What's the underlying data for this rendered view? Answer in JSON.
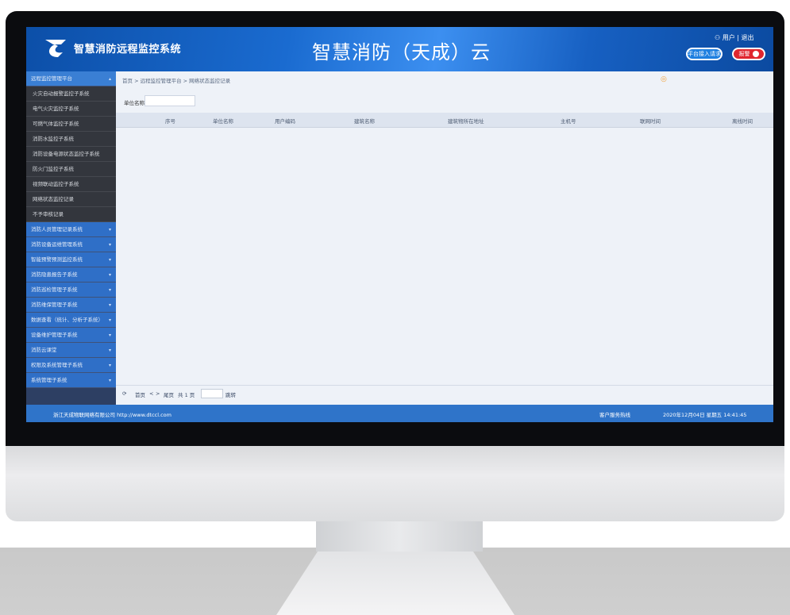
{
  "header": {
    "system_name": "智慧消防远程监控系统",
    "title": "智慧消防（天成）云",
    "user": "用户 | 退出",
    "button_alert": "平台接入请求",
    "button_alarm": "报警"
  },
  "sidebar": {
    "items": [
      {
        "label": "远程监控管理平台",
        "type": "active"
      },
      {
        "label": "火灾自动报警监控子系统",
        "type": "sub"
      },
      {
        "label": "电气火灾监控子系统",
        "type": "sub"
      },
      {
        "label": "可燃气体监控子系统",
        "type": "sub"
      },
      {
        "label": "消防水监控子系统",
        "type": "sub"
      },
      {
        "label": "消防设备电源状态监控子系统",
        "type": "sub"
      },
      {
        "label": "防火门监控子系统",
        "type": "sub"
      },
      {
        "label": "视频联动监控子系统",
        "type": "sub"
      },
      {
        "label": "网络状态监控记录",
        "type": "sub"
      },
      {
        "label": "不予审核记录",
        "type": "sub"
      },
      {
        "label": "消防人员管理记录系统",
        "type": "group"
      },
      {
        "label": "消防设备运维管理系统",
        "type": "group"
      },
      {
        "label": "智能预警预测监控系统",
        "type": "group"
      },
      {
        "label": "消防隐患报告子系统",
        "type": "group"
      },
      {
        "label": "消防巡检管理子系统",
        "type": "group"
      },
      {
        "label": "消防维保管理子系统",
        "type": "group"
      },
      {
        "label": "数据查看（统计、分析子系统）",
        "type": "group"
      },
      {
        "label": "设备维护管理子系统",
        "type": "group"
      },
      {
        "label": "消防云课堂",
        "type": "group"
      },
      {
        "label": "权限及系统管理子系统",
        "type": "group"
      },
      {
        "label": "系统管理子系统",
        "type": "group"
      }
    ]
  },
  "content": {
    "breadcrumb": "首页 > 远程监控管理平台 > 网络状态监控记录",
    "filter_label": "单位名称",
    "columns": [
      "序号",
      "单位名称",
      "用户编码",
      "建筑名称",
      "建筑物所在地址",
      "主机号",
      "联网时间",
      "离线时间"
    ]
  },
  "pager": {
    "first": "首页",
    "prev": "<",
    "next": ">",
    "last": "尾页",
    "total": "共 1 页",
    "go": "跳转"
  },
  "footer": {
    "company": "浙江天成物联网络有限公司 http://www.dtccl.com",
    "hotline": "客户服务热线",
    "datetime": "2020年12月04日 星期五 14:41:45"
  }
}
